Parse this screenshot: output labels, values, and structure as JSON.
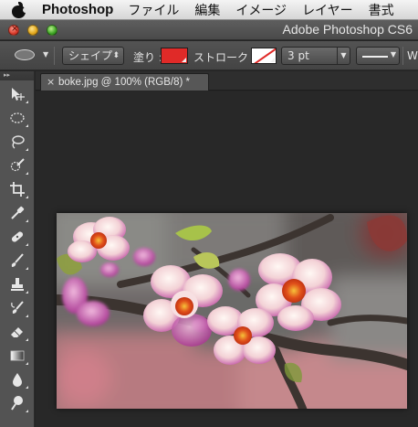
{
  "menubar": {
    "apple_icon": "apple-logo-icon",
    "app_name": "Photoshop",
    "items": [
      "ファイル",
      "編集",
      "イメージ",
      "レイヤー",
      "書式"
    ]
  },
  "window": {
    "title": "Adobe Photoshop CS6",
    "close_glyph": "×"
  },
  "options": {
    "shape_mode": "シェイプ",
    "fill_label": "塗り :",
    "fill_color": "#e02a28",
    "stroke_label": "ストローク :",
    "stroke_width": "3 pt",
    "w_label": "W"
  },
  "toolbar": {
    "grip": "▸▸",
    "tools": [
      "move-tool-icon",
      "marquee-tool-icon",
      "lasso-tool-icon",
      "quick-select-tool-icon",
      "crop-tool-icon",
      "eyedropper-tool-icon",
      "healing-brush-tool-icon",
      "brush-tool-icon",
      "stamp-tool-icon",
      "history-brush-tool-icon",
      "eraser-tool-icon",
      "gradient-tool-icon",
      "blur-tool-icon",
      "dodge-tool-icon"
    ]
  },
  "document": {
    "tab_close": "×",
    "tab_title": "boke.jpg @ 100% (RGB/8) *"
  }
}
